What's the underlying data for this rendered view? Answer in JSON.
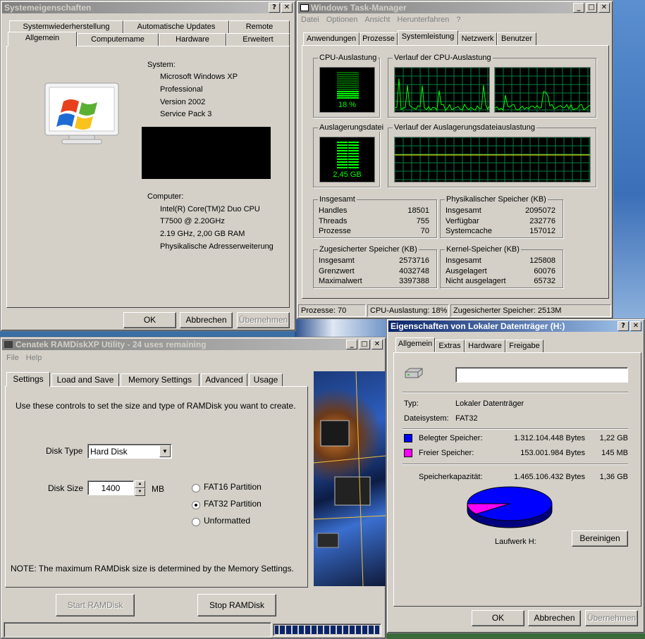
{
  "sysprop": {
    "title": "Systemeigenschaften",
    "tabs_row1": [
      "Systemwiederherstellung",
      "Automatische Updates",
      "Remote"
    ],
    "tabs_row2": [
      "Allgemein",
      "Computername",
      "Hardware",
      "Erweitert"
    ],
    "system_label": "System:",
    "os": "Microsoft Windows XP",
    "edition": "Professional",
    "version": "Version 2002",
    "sp": "Service Pack 3",
    "computer_label": "Computer:",
    "cpu1": "Intel(R) Core(TM)2 Duo CPU",
    "cpu2": "T7500  @ 2.20GHz",
    "cpu3": "2.19 GHz, 2,00 GB RAM",
    "pae": "Physikalische Adresserweiterung",
    "ok": "OK",
    "cancel": "Abbrechen",
    "apply": "Übernehmen"
  },
  "taskmgr": {
    "title": "Windows Task-Manager",
    "menu": [
      "Datei",
      "Optionen",
      "Ansicht",
      "Herunterfahren",
      "?"
    ],
    "tabs": [
      "Anwendungen",
      "Prozesse",
      "Systemleistung",
      "Netzwerk",
      "Benutzer"
    ],
    "cpu_usage_label": "CPU-Auslastung",
    "cpu_usage_value": "18 %",
    "cpu_hist_label": "Verlauf der CPU-Auslastung",
    "pf_label": "Auslagerungsdatei",
    "pf_value": "2,45 GB",
    "pf_hist_label": "Verlauf der Auslagerungsdateiauslastung",
    "totals": {
      "label": "Insgesamt",
      "rows": [
        [
          "Handles",
          "18501"
        ],
        [
          "Threads",
          "755"
        ],
        [
          "Prozesse",
          "70"
        ]
      ]
    },
    "phys": {
      "label": "Physikalischer Speicher (KB)",
      "rows": [
        [
          "Insgesamt",
          "2095072"
        ],
        [
          "Verfügbar",
          "232776"
        ],
        [
          "Systemcache",
          "157012"
        ]
      ]
    },
    "commit": {
      "label": "Zugesicherter Speicher (KB)",
      "rows": [
        [
          "Insgesamt",
          "2573716"
        ],
        [
          "Grenzwert",
          "4032748"
        ],
        [
          "Maximalwert",
          "3397388"
        ]
      ]
    },
    "kernel": {
      "label": "Kernel-Speicher (KB)",
      "rows": [
        [
          "Insgesamt",
          "125808"
        ],
        [
          "Ausgelagert",
          "60076"
        ],
        [
          "Nicht ausgelagert",
          "65732"
        ]
      ]
    },
    "status": [
      "Prozesse: 70",
      "CPU-Auslastung: 18%",
      "Zugesicherter Speicher: 2513M"
    ],
    "cpu_level": 0.18
  },
  "ramdisk": {
    "title": "Cenatek RAMDiskXP Utility - 24 uses remaining",
    "menu": [
      "File",
      "Help"
    ],
    "tabs": [
      "Settings",
      "Load and Save",
      "Memory Settings",
      "Advanced",
      "Usage"
    ],
    "intro": "Use these controls to set the size and type of RAMDisk you want to create.",
    "disk_type_label": "Disk Type",
    "disk_type_value": "Hard Disk",
    "disk_size_label": "Disk Size",
    "disk_size_value": "1400",
    "mb": "MB",
    "options": [
      "FAT16 Partition",
      "FAT32 Partition",
      "Unformatted"
    ],
    "note": "NOTE: The maximum RAMDisk size is determined by the Memory Settings.",
    "start": "Start RAMDisk",
    "stop": "Stop RAMDisk"
  },
  "drive": {
    "title": "Eigenschaften von Lokaler Datenträger (H:)",
    "tabs": [
      "Allgemein",
      "Extras",
      "Hardware",
      "Freigabe"
    ],
    "type_label": "Typ:",
    "type_value": "Lokaler Datenträger",
    "fs_label": "Dateisystem:",
    "fs_value": "FAT32",
    "used_label": "Belegter Speicher:",
    "used_bytes": "1.312.104.448 Bytes",
    "used_h": "1,22 GB",
    "free_label": "Freier Speicher:",
    "free_bytes": "153.001.984 Bytes",
    "free_h": "145 MB",
    "cap_label": "Speicherkapazität:",
    "cap_bytes": "1.465.106.432 Bytes",
    "cap_h": "1,36 GB",
    "drive_label": "Laufwerk H:",
    "cleanup": "Bereinigen",
    "ok": "OK",
    "cancel": "Abbrechen",
    "apply": "Übernehmen",
    "used_color": "#0000ff",
    "free_color": "#ff00ff",
    "free_fraction": 0.104
  }
}
